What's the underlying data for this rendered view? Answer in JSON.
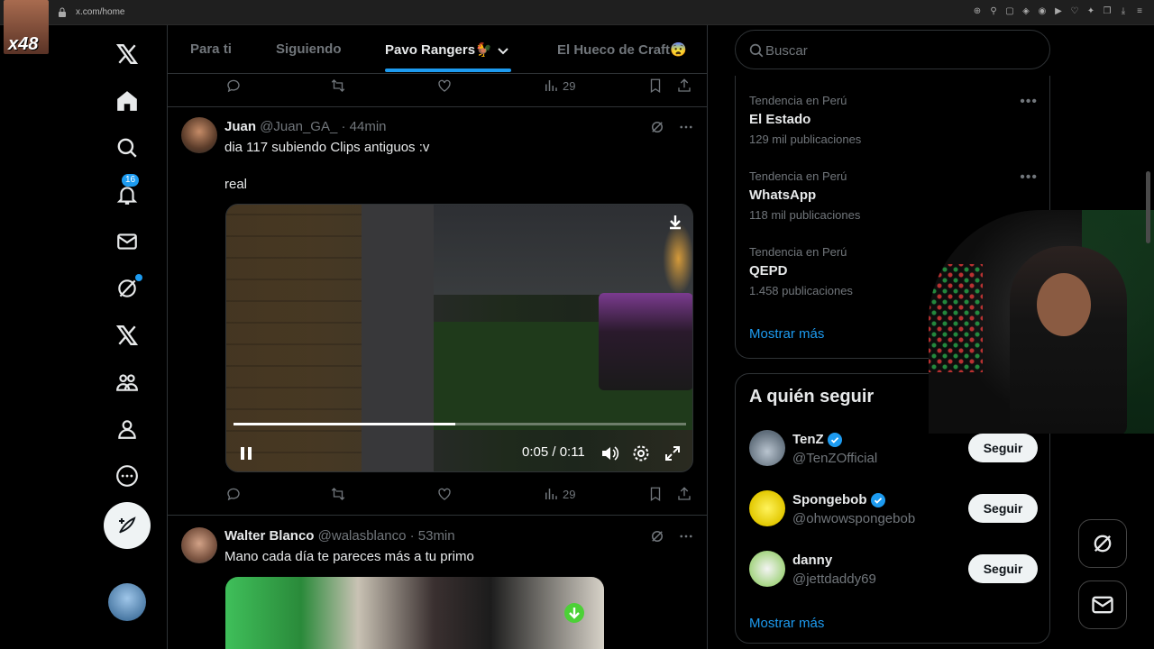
{
  "browser": {
    "url": "x.com/home",
    "overlay_badge": "x48"
  },
  "tabs": [
    {
      "label": "Para ti"
    },
    {
      "label": "Siguiendo"
    },
    {
      "label": "Pavo Rangers🐓"
    },
    {
      "label": "El Hueco de Craft😨"
    }
  ],
  "nav": {
    "notifications_count": "16"
  },
  "top_actions": {
    "views": "29"
  },
  "tweets": [
    {
      "name": "Juan",
      "handle": "@Juan_GA_",
      "time": "· 44min",
      "text": "dia 117 subiendo Clips antiguos :v",
      "text2": "real",
      "video_time": "0:05 / 0:11",
      "video_progress": 0.49,
      "views": "29"
    },
    {
      "name": "Walter Blanco",
      "handle": "@walasblanco",
      "time": "· 53min",
      "text": "Mano cada día te pareces más a tu primo"
    }
  ],
  "search": {
    "placeholder": "Buscar"
  },
  "trends": [
    {
      "context": "Tendencia en Perú",
      "title": "El Estado",
      "count": "129 mil publicaciones"
    },
    {
      "context": "Tendencia en Perú",
      "title": "WhatsApp",
      "count": "118 mil publicaciones"
    },
    {
      "context": "Tendencia en Perú",
      "title": "QEPD",
      "count": "1.458 publicaciones"
    }
  ],
  "trends_more": "Mostrar más",
  "who_to_follow": {
    "title": "A quién seguir",
    "accounts": [
      {
        "name": "TenZ",
        "handle": "@TenZOfficial",
        "verified": true,
        "button": "Seguir"
      },
      {
        "name": "Spongebob",
        "handle": "@ohwowspongebob",
        "verified": true,
        "button": "Seguir"
      },
      {
        "name": "danny",
        "handle": "@jettdaddy69",
        "verified": false,
        "button": "Seguir"
      }
    ],
    "more": "Mostrar más"
  },
  "colors": {
    "accent": "#1d9bf0",
    "background": "#000000",
    "border": "#2f3336",
    "muted": "#71767b"
  }
}
